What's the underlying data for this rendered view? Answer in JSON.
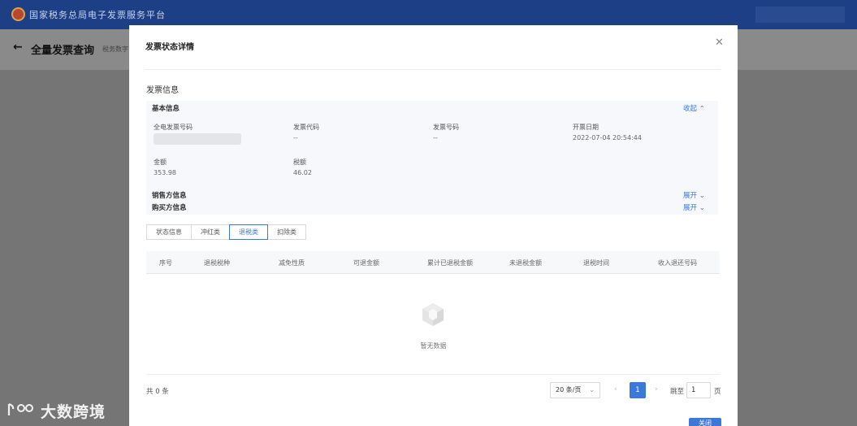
{
  "app": {
    "title": "国家税务总局电子发票服务平台"
  },
  "page": {
    "title": "全量发票查询",
    "subtitle": "税务数字",
    "back_icon": "arrow-left-icon"
  },
  "modal": {
    "title": "发票状态详情",
    "close_icon": "close-icon",
    "section_title": "发票信息",
    "basic": {
      "header": "基本信息",
      "toggle": "收起",
      "fields": [
        {
          "label": "全电发票号码",
          "value": ""
        },
        {
          "label": "发票代码",
          "value": "--"
        },
        {
          "label": "发票号码",
          "value": "--"
        },
        {
          "label": "开票日期",
          "value": "2022-07-04 20:54:44"
        },
        {
          "label": "金额",
          "value": "353.98"
        },
        {
          "label": "税额",
          "value": "46.02"
        }
      ]
    },
    "seller": {
      "header": "销售方信息",
      "toggle": "展开"
    },
    "buyer": {
      "header": "购买方信息",
      "toggle": "展开"
    },
    "tabs": [
      {
        "label": "状态信息",
        "active": false
      },
      {
        "label": "冲红类",
        "active": false
      },
      {
        "label": "退税类",
        "active": true
      },
      {
        "label": "扣除类",
        "active": false
      }
    ],
    "table": {
      "columns": [
        "序号",
        "退税税种",
        "减免性质",
        "可退金额",
        "累计已退税金额",
        "未退税金额",
        "退税时间",
        "收入退还号码"
      ],
      "rows": [],
      "empty_text": "暂无数据"
    },
    "footer": {
      "total": "共 0 条",
      "page_size": "20 条/页",
      "current_page": "1",
      "jump_label": "跳至",
      "jump_value": "1",
      "jump_suffix": "页",
      "close_button": "关闭"
    }
  },
  "watermark": {
    "text": "大数跨境"
  },
  "colors": {
    "primary": "#3d77d8",
    "topbar": "#1d3f86"
  }
}
